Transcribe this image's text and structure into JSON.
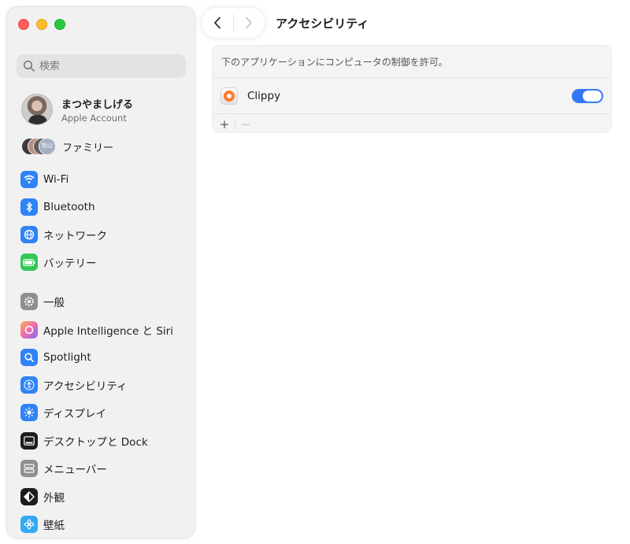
{
  "window": {
    "title": "アクセシビリティ"
  },
  "search": {
    "placeholder": "検索"
  },
  "account": {
    "name": "まつやましげる",
    "subtitle": "Apple Account"
  },
  "family": {
    "label": "ファミリー",
    "avatar_badge": "松山"
  },
  "sidebar": {
    "items": [
      {
        "label": "Wi-Fi",
        "icon": "wifi-icon",
        "color": "#2f83f6"
      },
      {
        "label": "Bluetooth",
        "icon": "bluetooth-icon",
        "color": "#2f83f6"
      },
      {
        "label": "ネットワーク",
        "icon": "globe-icon",
        "color": "#2f83f6"
      },
      {
        "label": "バッテリー",
        "icon": "battery-icon",
        "color": "#34c759"
      },
      {
        "label": "一般",
        "icon": "gear-icon",
        "color": "#8e8e93"
      },
      {
        "label": "Apple Intelligence と Siri",
        "icon": "apple-intelligence-icon",
        "color": "#f5a35b"
      },
      {
        "label": "Spotlight",
        "icon": "magnifier-icon",
        "color": "#2f83f6"
      },
      {
        "label": "アクセシビリティ",
        "icon": "accessibility-icon",
        "color": "#2f83f6"
      },
      {
        "label": "ディスプレイ",
        "icon": "sun-icon",
        "color": "#2f83f6"
      },
      {
        "label": "デスクトップと Dock",
        "icon": "dock-icon",
        "color": "#1d1d1f"
      },
      {
        "label": "メニューバー",
        "icon": "menubar-icon",
        "color": "#8e8e93"
      },
      {
        "label": "外観",
        "icon": "appearance-icon",
        "color": "#1d1d1f"
      },
      {
        "label": "壁紙",
        "icon": "wallpaper-icon",
        "color": "#35a9f2"
      }
    ]
  },
  "main": {
    "description": "下のアプリケーションにコンピュータの制御を許可。",
    "apps": [
      {
        "name": "Clippy",
        "enabled": true
      }
    ],
    "footer": {
      "add": "+",
      "remove": "−"
    }
  },
  "nav": {
    "back": "‹",
    "forward": "›"
  }
}
